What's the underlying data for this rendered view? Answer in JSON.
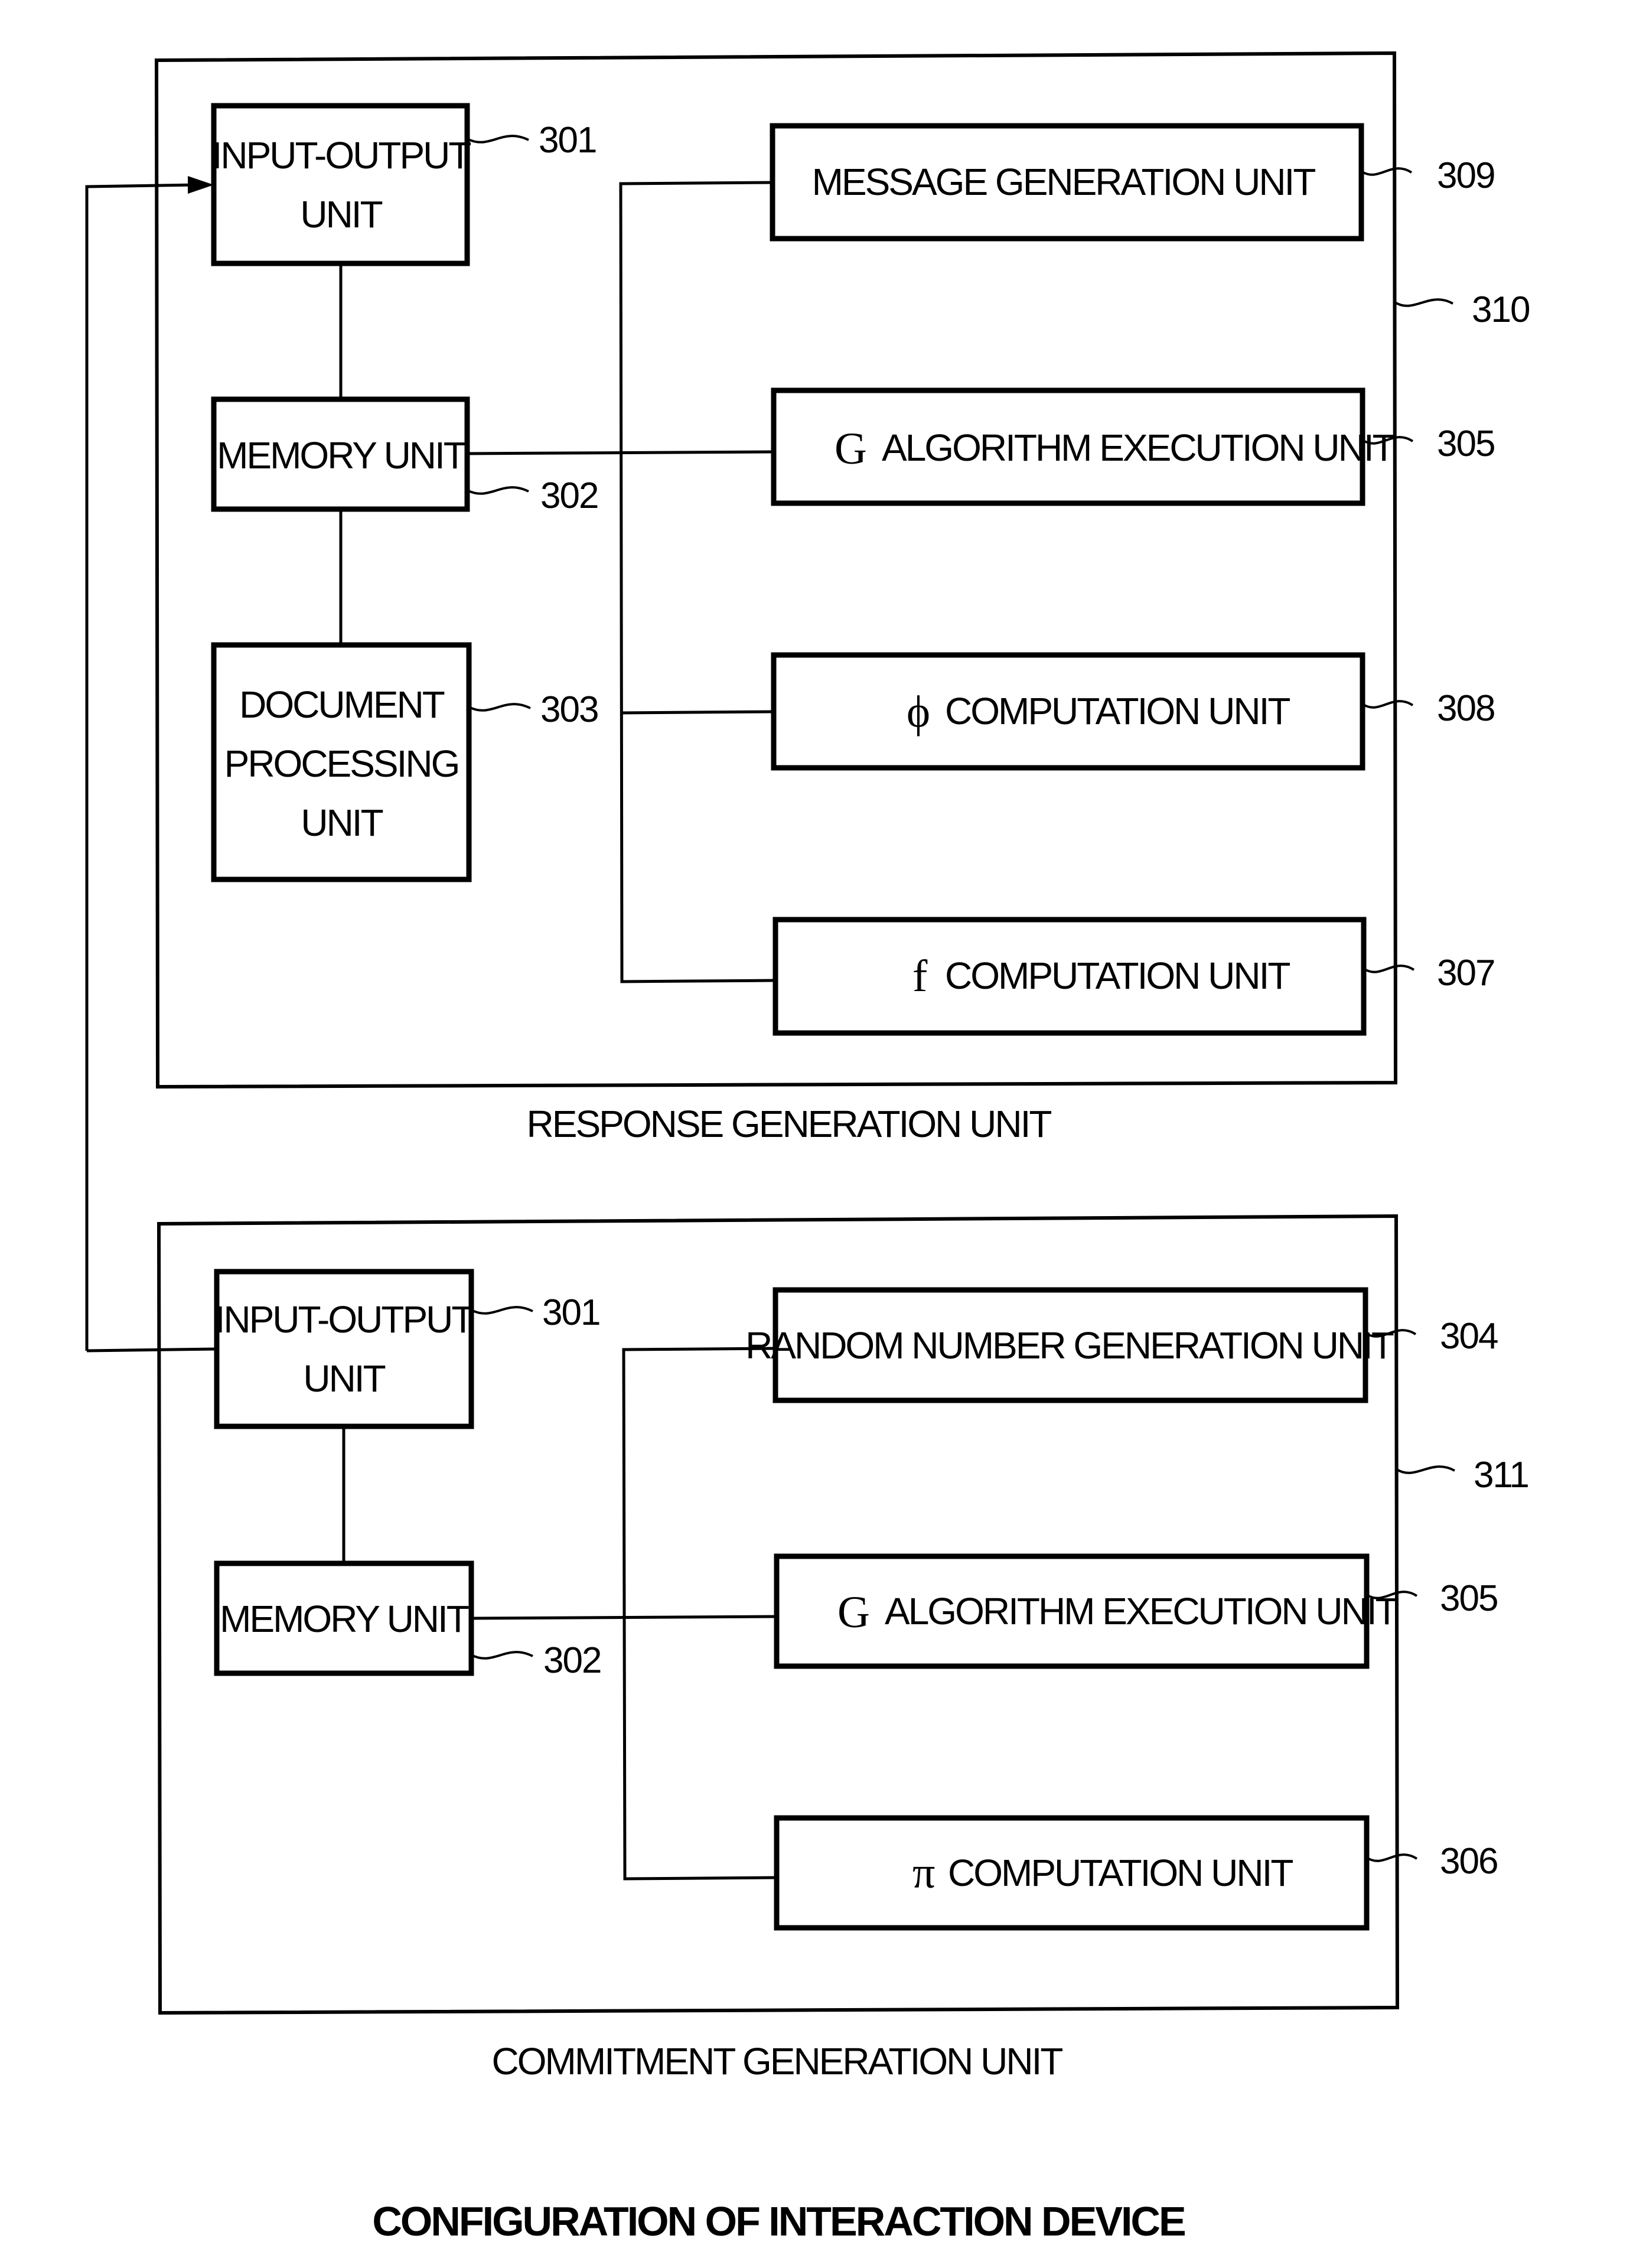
{
  "figure": {
    "title": "CONFIGURATION OF INTERACTION DEVICE"
  },
  "response_unit": {
    "caption": "RESPONSE GENERATION UNIT",
    "ref": "310",
    "io": {
      "lines": [
        "INPUT-OUTPUT",
        "UNIT"
      ],
      "ref": "301"
    },
    "memory": {
      "lines": [
        "MEMORY UNIT"
      ],
      "ref": "302"
    },
    "document": {
      "lines": [
        "DOCUMENT",
        "PROCESSING",
        "UNIT"
      ],
      "ref": "303"
    },
    "message": {
      "symbol": "",
      "label": "MESSAGE GENERATION UNIT",
      "ref": "309"
    },
    "g_algo": {
      "symbol": "G",
      "label": "ALGORITHM EXECUTION UNIT",
      "ref": "305"
    },
    "phi": {
      "symbol": "ϕ",
      "label": "COMPUTATION UNIT",
      "ref": "308"
    },
    "f": {
      "symbol": "f",
      "label": "COMPUTATION UNIT",
      "ref": "307"
    }
  },
  "commitment_unit": {
    "caption": "COMMITMENT GENERATION UNIT",
    "ref": "311",
    "io": {
      "lines": [
        "INPUT-OUTPUT",
        "UNIT"
      ],
      "ref": "301"
    },
    "memory": {
      "lines": [
        "MEMORY UNIT"
      ],
      "ref": "302"
    },
    "random": {
      "symbol": "",
      "label": "RANDOM NUMBER GENERATION UNIT",
      "ref": "304"
    },
    "g_algo": {
      "symbol": "G",
      "label": "ALGORITHM EXECUTION UNIT",
      "ref": "305"
    },
    "pi": {
      "symbol": "π",
      "label": "COMPUTATION UNIT",
      "ref": "306"
    }
  }
}
